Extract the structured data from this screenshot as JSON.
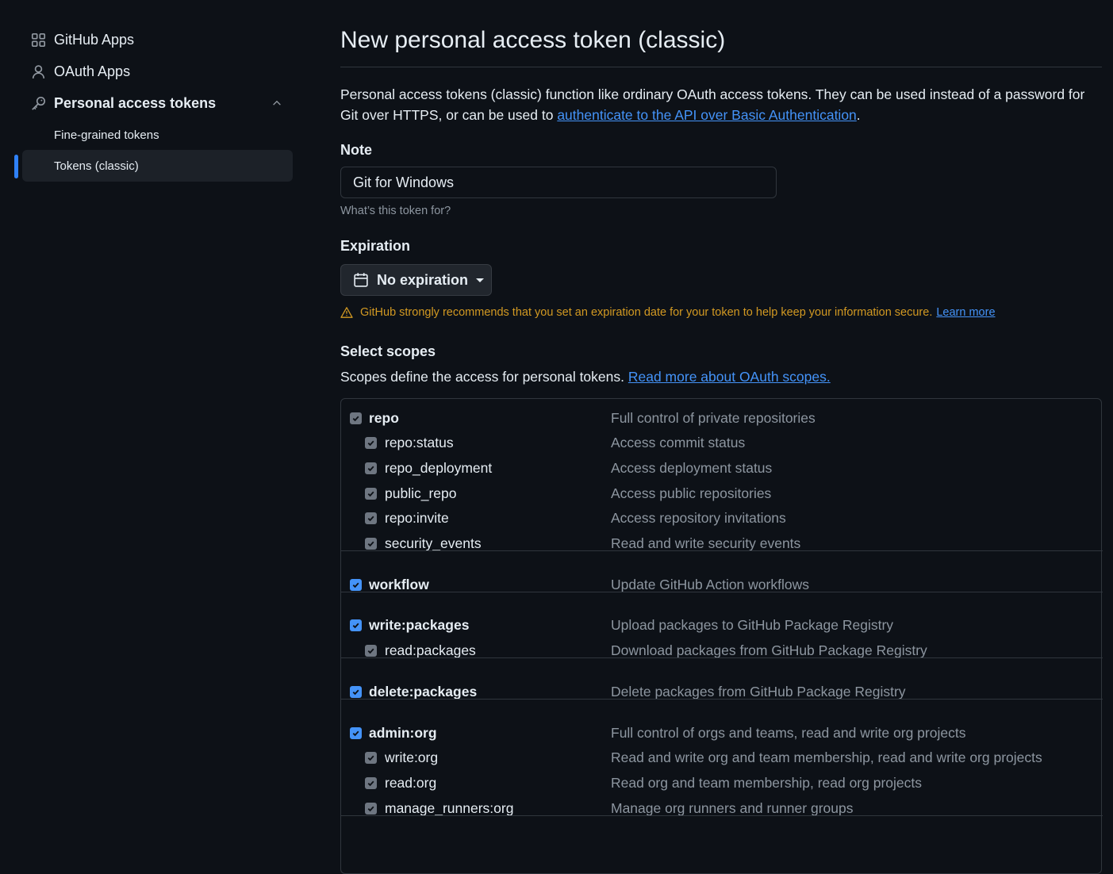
{
  "sidebar": {
    "items": [
      {
        "label": "GitHub Apps",
        "icon": "apps-grid-icon"
      },
      {
        "label": "OAuth Apps",
        "icon": "person-icon"
      },
      {
        "label": "Personal access tokens",
        "icon": "key-icon"
      }
    ],
    "sub_items": [
      {
        "label": "Fine-grained tokens"
      },
      {
        "label": "Tokens (classic)",
        "active": true
      }
    ]
  },
  "main": {
    "title": "New personal access token (classic)",
    "intro_text": "Personal access tokens (classic) function like ordinary OAuth access tokens. They can be used instead of a password for Git over HTTPS, or can be used to ",
    "intro_link": "authenticate to the API over Basic Authentication",
    "intro_end": ".",
    "note": {
      "label": "Note",
      "value": "Git for Windows",
      "hint": "What’s this token for?"
    },
    "expiration": {
      "label": "Expiration",
      "selected": "No expiration",
      "warning": "GitHub strongly recommends that you set an expiration date for your token to help keep your information secure.",
      "learn_more": "Learn more"
    },
    "scopes": {
      "heading": "Select scopes",
      "desc": "Scopes define the access for personal tokens. ",
      "desc_link": "Read more about OAuth scopes."
    }
  },
  "scope_groups": [
    {
      "name": "repo",
      "desc": "Full control of private repositories",
      "children": [
        {
          "name": "repo:status",
          "desc": "Access commit status"
        },
        {
          "name": "repo_deployment",
          "desc": "Access deployment status"
        },
        {
          "name": "public_repo",
          "desc": "Access public repositories"
        },
        {
          "name": "repo:invite",
          "desc": "Access repository invitations"
        },
        {
          "name": "security_events",
          "desc": "Read and write security events"
        }
      ]
    },
    {
      "name": "workflow",
      "desc": "Update GitHub Action workflows",
      "children": []
    },
    {
      "name": "write:packages",
      "desc": "Upload packages to GitHub Package Registry",
      "children": [
        {
          "name": "read:packages",
          "desc": "Download packages from GitHub Package Registry"
        }
      ]
    },
    {
      "name": "delete:packages",
      "desc": "Delete packages from GitHub Package Registry",
      "children": []
    },
    {
      "name": "admin:org",
      "desc": "Full control of orgs and teams, read and write org projects",
      "children": [
        {
          "name": "write:org",
          "desc": "Read and write org and team membership, read and write org projects"
        },
        {
          "name": "read:org",
          "desc": "Read org and team membership, read org projects"
        },
        {
          "name": "manage_runners:org",
          "desc": "Manage org runners and runner groups"
        }
      ]
    }
  ],
  "colors": {
    "background": "#0d1117",
    "accent": "#4493f8",
    "warning": "#d29922",
    "muted": "#8d96a0",
    "border": "#30363d"
  }
}
